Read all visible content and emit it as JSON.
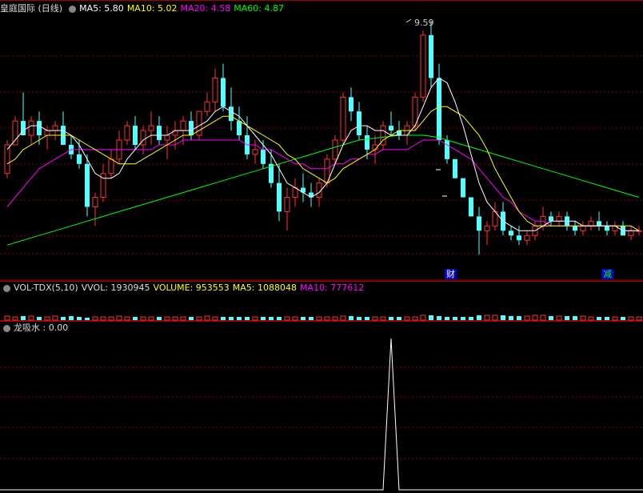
{
  "main_header": {
    "stock_name": "皇庭国际 (日线)",
    "ma5": "MA5: 5.80",
    "ma10": "MA10: 5.02",
    "ma20": "MA20: 4.58",
    "ma60": "MA60: 4.87"
  },
  "vol_header": {
    "name": "VOL-TDX(5,10)",
    "vvol": "VVOL: 1930945",
    "volume": "VOLUME: 953553",
    "ma5": "MA5: 1088048",
    "ma10": "MA10: 777612"
  },
  "ind_header": {
    "name": "龙吸水 : 0.00"
  },
  "annotations": {
    "high_label": "9.59",
    "event1": "财",
    "event2": "减"
  },
  "colors": {
    "bg": "#000000",
    "up": "#ff3232",
    "down": "#54ffff",
    "ma5": "#ffffff",
    "ma10": "#ffff00",
    "ma20": "#ff00ff",
    "ma60": "#00ff00",
    "grid": "#8b0000",
    "event_box": "#0000cc",
    "event_text_1": "#ffffff",
    "event_text_2": "#00ff00"
  },
  "chart_data": [
    {
      "type": "candlestick",
      "ohlc": [
        [
          4.3,
          5.0,
          4.2,
          4.9
        ],
        [
          4.9,
          5.5,
          4.9,
          5.4
        ],
        [
          5.4,
          6.0,
          5.2,
          5.1
        ],
        [
          5.1,
          5.5,
          4.9,
          5.4
        ],
        [
          5.4,
          5.6,
          4.9,
          5.1
        ],
        [
          5.1,
          5.3,
          4.8,
          5.2
        ],
        [
          5.2,
          5.4,
          5.0,
          5.3
        ],
        [
          5.3,
          5.6,
          5.1,
          4.9
        ],
        [
          4.9,
          5.1,
          4.6,
          4.7
        ],
        [
          4.7,
          5.0,
          4.4,
          4.5
        ],
        [
          4.5,
          4.7,
          3.4,
          3.6
        ],
        [
          3.6,
          3.9,
          3.2,
          3.8
        ],
        [
          3.8,
          4.5,
          3.7,
          4.3
        ],
        [
          4.3,
          4.8,
          4.2,
          4.6
        ],
        [
          4.6,
          5.2,
          4.5,
          5.0
        ],
        [
          5.0,
          5.4,
          4.9,
          5.3
        ],
        [
          5.3,
          5.5,
          4.8,
          4.9
        ],
        [
          4.9,
          5.3,
          4.7,
          5.2
        ],
        [
          5.2,
          5.6,
          4.9,
          5.3
        ],
        [
          5.3,
          5.5,
          4.9,
          5.0
        ],
        [
          5.0,
          5.3,
          4.6,
          5.1
        ],
        [
          5.1,
          5.4,
          4.8,
          5.2
        ],
        [
          5.2,
          5.5,
          4.9,
          5.4
        ],
        [
          5.4,
          5.6,
          5.0,
          5.1
        ],
        [
          5.1,
          5.6,
          5.0,
          5.6
        ],
        [
          5.6,
          6.0,
          5.5,
          5.8
        ],
        [
          5.8,
          6.5,
          5.6,
          6.3
        ],
        [
          6.3,
          6.6,
          5.6,
          5.7
        ],
        [
          5.7,
          6.1,
          5.2,
          5.4
        ],
        [
          5.4,
          5.7,
          5.0,
          5.1
        ],
        [
          5.1,
          5.5,
          4.6,
          4.7
        ],
        [
          4.7,
          5.0,
          4.5,
          4.8
        ],
        [
          4.8,
          5.0,
          4.4,
          4.5
        ],
        [
          4.5,
          4.8,
          4.0,
          4.1
        ],
        [
          4.1,
          4.5,
          3.3,
          3.5
        ],
        [
          3.5,
          4.0,
          3.1,
          3.8
        ],
        [
          3.8,
          4.2,
          3.6,
          4.0
        ],
        [
          4.0,
          4.3,
          3.7,
          3.9
        ],
        [
          3.9,
          4.1,
          3.6,
          3.8
        ],
        [
          3.8,
          4.2,
          3.6,
          4.1
        ],
        [
          4.1,
          4.7,
          4.0,
          4.6
        ],
        [
          4.6,
          5.1,
          4.5,
          5.0
        ],
        [
          5.0,
          6.0,
          4.9,
          5.9
        ],
        [
          5.9,
          6.1,
          5.4,
          5.6
        ],
        [
          5.6,
          5.8,
          5.0,
          5.1
        ],
        [
          5.1,
          5.3,
          4.6,
          4.8
        ],
        [
          4.8,
          5.1,
          4.5,
          4.9
        ],
        [
          4.9,
          5.4,
          4.8,
          5.3
        ],
        [
          5.3,
          5.6,
          5.1,
          5.2
        ],
        [
          5.2,
          5.4,
          5.0,
          5.1
        ],
        [
          5.1,
          5.4,
          4.9,
          5.3
        ],
        [
          5.3,
          6.0,
          5.2,
          5.9
        ],
        [
          5.9,
          7.3,
          5.8,
          7.2
        ],
        [
          7.2,
          7.5,
          6.1,
          6.3
        ],
        [
          6.3,
          6.6,
          4.9,
          5.0
        ],
        [
          5.0,
          5.1,
          4.5,
          4.6
        ],
        [
          4.6,
          4.6,
          4.2,
          4.2
        ],
        [
          4.2,
          4.2,
          3.8,
          3.8
        ],
        [
          3.8,
          3.8,
          3.4,
          3.4
        ],
        [
          3.4,
          3.6,
          2.6,
          3.1
        ],
        [
          3.1,
          3.3,
          2.8,
          3.2
        ],
        [
          3.2,
          3.7,
          3.1,
          3.5
        ],
        [
          3.5,
          3.7,
          3.0,
          3.1
        ],
        [
          3.1,
          3.2,
          2.9,
          3.0
        ],
        [
          3.0,
          3.2,
          2.8,
          2.9
        ],
        [
          2.9,
          3.1,
          2.8,
          3.0
        ],
        [
          3.0,
          3.3,
          2.9,
          3.2
        ],
        [
          3.2,
          3.6,
          3.1,
          3.4
        ],
        [
          3.4,
          3.5,
          3.2,
          3.3
        ],
        [
          3.3,
          3.5,
          3.2,
          3.4
        ],
        [
          3.4,
          3.5,
          3.1,
          3.2
        ],
        [
          3.2,
          3.3,
          3.0,
          3.1
        ],
        [
          3.1,
          3.3,
          3.0,
          3.2
        ],
        [
          3.2,
          3.4,
          3.1,
          3.3
        ],
        [
          3.3,
          3.5,
          3.1,
          3.2
        ],
        [
          3.2,
          3.3,
          3.0,
          3.1
        ],
        [
          3.1,
          3.3,
          3.0,
          3.2
        ],
        [
          3.2,
          3.3,
          3.0,
          3.0
        ],
        [
          3.0,
          3.2,
          2.9,
          3.1
        ],
        [
          3.1,
          3.2,
          3.0,
          3.1
        ]
      ],
      "ma5": [
        4.8,
        5.0,
        5.2,
        5.3,
        5.3,
        5.2,
        5.2,
        5.2,
        5.1,
        4.9,
        4.6,
        4.3,
        4.2,
        4.2,
        4.3,
        4.6,
        4.8,
        5.0,
        5.1,
        5.1,
        5.1,
        5.2,
        5.2,
        5.2,
        5.3,
        5.4,
        5.6,
        5.7,
        5.6,
        5.5,
        5.3,
        5.1,
        4.9,
        4.7,
        4.4,
        4.1,
        4.0,
        3.9,
        3.8,
        3.9,
        4.1,
        4.5,
        4.9,
        5.2,
        5.3,
        5.3,
        5.2,
        5.2,
        5.1,
        5.1,
        5.1,
        5.3,
        5.7,
        6.1,
        6.3,
        6.2,
        5.8,
        5.3,
        4.7,
        4.1,
        3.7,
        3.5,
        3.3,
        3.2,
        3.1,
        3.1,
        3.1,
        3.2,
        3.3,
        3.3,
        3.3,
        3.3,
        3.2,
        3.2,
        3.2,
        3.2,
        3.2,
        3.1,
        3.1,
        3.1
      ],
      "ma10": [
        4.5,
        4.6,
        4.8,
        4.9,
        5.0,
        5.1,
        5.1,
        5.1,
        5.1,
        5.0,
        4.9,
        4.8,
        4.7,
        4.6,
        4.5,
        4.5,
        4.5,
        4.6,
        4.7,
        4.8,
        4.9,
        5.0,
        5.1,
        5.1,
        5.2,
        5.3,
        5.4,
        5.5,
        5.5,
        5.4,
        5.3,
        5.2,
        5.1,
        5.0,
        4.9,
        4.7,
        4.6,
        4.4,
        4.3,
        4.2,
        4.1,
        4.2,
        4.4,
        4.5,
        4.6,
        4.7,
        4.8,
        5.0,
        5.1,
        5.2,
        5.2,
        5.2,
        5.4,
        5.6,
        5.7,
        5.7,
        5.6,
        5.5,
        5.3,
        5.1,
        4.8,
        4.4,
        4.1,
        3.8,
        3.5,
        3.3,
        3.2,
        3.2,
        3.2,
        3.2,
        3.2,
        3.2,
        3.2,
        3.2,
        3.2,
        3.2,
        3.2,
        3.2,
        3.2,
        3.1
      ],
      "ma20": [
        3.6,
        3.8,
        4.0,
        4.2,
        4.4,
        4.5,
        4.6,
        4.7,
        4.8,
        4.8,
        4.8,
        4.8,
        4.8,
        4.8,
        4.8,
        4.8,
        4.8,
        4.8,
        4.8,
        4.9,
        4.9,
        4.9,
        5.0,
        5.0,
        5.0,
        5.0,
        5.0,
        5.0,
        5.0,
        5.0,
        4.9,
        4.9,
        4.8,
        4.8,
        4.7,
        4.6,
        4.5,
        4.5,
        4.4,
        4.4,
        4.4,
        4.5,
        4.5,
        4.6,
        4.6,
        4.7,
        4.7,
        4.8,
        4.8,
        4.8,
        4.8,
        4.9,
        5.0,
        5.0,
        5.0,
        4.9,
        4.8,
        4.7,
        4.6,
        4.4,
        4.2,
        4.0,
        3.8,
        3.7,
        3.5,
        3.4,
        3.3,
        3.3,
        3.2,
        3.2,
        3.2,
        3.2,
        3.2,
        3.2,
        3.2,
        3.2,
        3.2,
        3.1,
        3.1,
        3.1
      ],
      "ma60": [
        2.8,
        2.85,
        2.9,
        2.95,
        3.0,
        3.05,
        3.1,
        3.15,
        3.2,
        3.25,
        3.3,
        3.35,
        3.4,
        3.45,
        3.5,
        3.55,
        3.6,
        3.65,
        3.7,
        3.75,
        3.8,
        3.85,
        3.9,
        3.95,
        4.0,
        4.05,
        4.1,
        4.15,
        4.2,
        4.25,
        4.3,
        4.35,
        4.4,
        4.45,
        4.5,
        4.55,
        4.6,
        4.65,
        4.7,
        4.75,
        4.8,
        4.85,
        4.9,
        4.95,
        5.0,
        5.02,
        5.04,
        5.06,
        5.08,
        5.1,
        5.1,
        5.1,
        5.1,
        5.08,
        5.05,
        5.0,
        4.95,
        4.9,
        4.85,
        4.8,
        4.75,
        4.7,
        4.65,
        4.6,
        4.55,
        4.5,
        4.45,
        4.4,
        4.35,
        4.3,
        4.25,
        4.2,
        4.15,
        4.1,
        4.05,
        4.0,
        3.95,
        3.9,
        3.85,
        3.8
      ],
      "high_label_value": 9.59
    },
    {
      "type": "bar",
      "name": "VOL-TDX(5,10)",
      "values": [
        5,
        4,
        5,
        5,
        4,
        4,
        5,
        4,
        5,
        4,
        3,
        4,
        4,
        4,
        5,
        4,
        4,
        4,
        4,
        4,
        4,
        4,
        4,
        4,
        4,
        5,
        4,
        4,
        4,
        4,
        4,
        4,
        4,
        4,
        4,
        4,
        4,
        4,
        4,
        4,
        4,
        4,
        5,
        5,
        4,
        4,
        4,
        4,
        4,
        4,
        4,
        4,
        6,
        6,
        5,
        4,
        4,
        4,
        4,
        6,
        6,
        6,
        6,
        5,
        5,
        5,
        6,
        6,
        5,
        5,
        5,
        5,
        5,
        4,
        4,
        4,
        4,
        4,
        4,
        4
      ]
    },
    {
      "type": "line",
      "name": "龙吸水",
      "values": [
        0,
        0,
        0,
        0,
        0,
        0,
        0,
        0,
        0,
        0,
        0,
        0,
        0,
        0,
        0,
        0,
        0,
        0,
        0,
        0,
        0,
        0,
        0,
        0,
        0,
        0,
        0,
        0,
        0,
        0,
        0,
        0,
        0,
        0,
        0,
        0,
        0,
        0,
        0,
        0,
        0,
        0,
        0,
        0,
        0,
        0,
        0,
        0,
        0,
        0,
        0,
        0,
        0,
        0,
        0,
        0,
        0,
        0,
        0,
        0,
        0,
        0,
        0,
        0,
        0,
        0,
        0,
        0,
        0,
        0,
        0,
        0,
        0,
        0,
        0,
        0,
        0,
        0,
        0,
        0
      ],
      "spike_index": 48,
      "spike_value": 1
    }
  ]
}
